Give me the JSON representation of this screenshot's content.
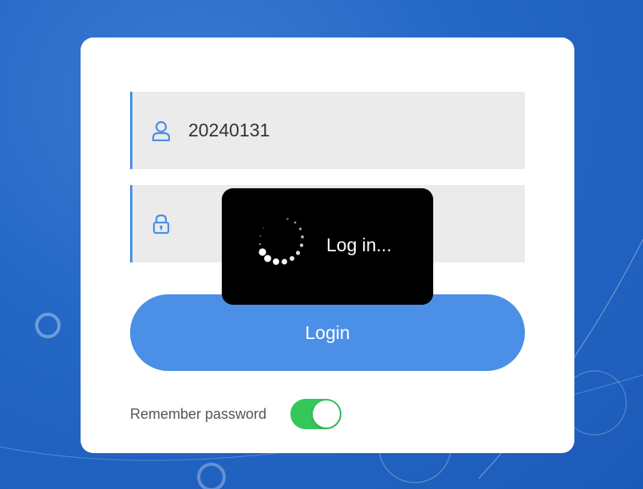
{
  "login_form": {
    "username": {
      "icon": "user-icon",
      "value": "20240131"
    },
    "password": {
      "icon": "lock-icon",
      "value": ""
    },
    "login_button_label": "Login",
    "remember_password": {
      "label": "Remember password",
      "enabled": true
    }
  },
  "loading": {
    "icon": "spinner-icon",
    "message": "Log in..."
  },
  "colors": {
    "background": "#2467c5",
    "accent": "#4b8fe6",
    "field_bg": "#ebebeb",
    "toggle_on": "#34c759",
    "overlay_bg": "#000000"
  }
}
